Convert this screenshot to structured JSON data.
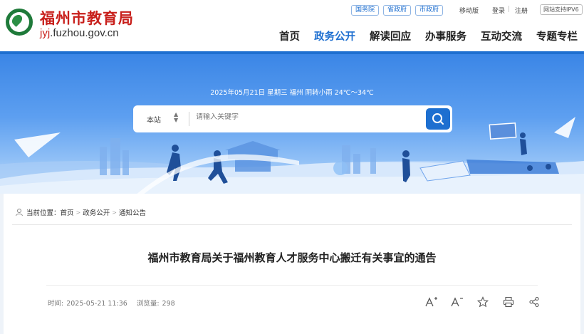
{
  "header": {
    "site_name": "福州市教育局",
    "domain_prefix": "jyj",
    "domain_suffix": ".fuzhou.gov.cn",
    "top_links": [
      "国务院",
      "省政府",
      "市政府"
    ],
    "mobile": "移动版",
    "login": "登录",
    "divider": "|",
    "register": "注册",
    "ipv6": "网站支持IPV6"
  },
  "nav": {
    "items": [
      "首页",
      "政务公开",
      "解读回应",
      "办事服务",
      "互动交流",
      "专题专栏"
    ],
    "active_index": 1
  },
  "banner": {
    "date_weather": "2025年05月21日 星期三    福州 阴转小雨 24℃～34℃"
  },
  "search": {
    "scope": "本站",
    "placeholder": "请输入关键字"
  },
  "breadcrumb": {
    "label": "当前位置：",
    "items": [
      "首页",
      "政务公开",
      "通知公告"
    ]
  },
  "article": {
    "title": "福州市教育局关于福州教育人才服务中心搬迁有关事宜的通告",
    "time_label": "时间:",
    "time": "2025-05-21 11:36",
    "views_label": "浏览量:",
    "views": "298"
  },
  "colors": {
    "accent": "#1e6fd0",
    "brand_red": "#c8201c"
  }
}
